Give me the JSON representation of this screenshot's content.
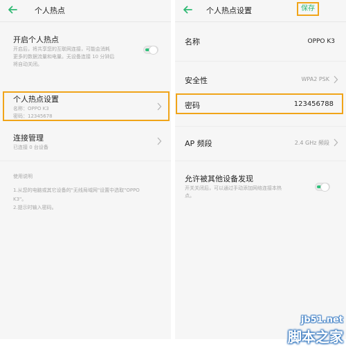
{
  "left_screen": {
    "header": {
      "title": "个人热点"
    },
    "hotspot_toggle": {
      "title": "开启个人热点",
      "description_lines": [
        "开启后，将共享您的互联网连接，可能会消耗",
        "更多的数据流量和电量。无设备连接 10 分钟后",
        "将自动关闭。"
      ],
      "enabled": true
    },
    "hotspot_settings": {
      "title": "个人热点设置",
      "name_line": "名称：OPPO K3",
      "password_line": "密码：12345678"
    },
    "connection_management": {
      "title": "连接管理",
      "subtitle": "已连接 0 台设备"
    },
    "instructions": {
      "heading": "使用说明",
      "lines": [
        "1.从您的电脑或其它设备的\"无线局域网\"设置中选取\"OPPO",
        "K3\"。",
        "2.提示时输入密码。"
      ]
    }
  },
  "right_screen": {
    "header": {
      "title": "个人热点设置",
      "save_label": "保存"
    },
    "name_field": {
      "label": "名称",
      "value": "OPPO K3"
    },
    "security_field": {
      "label": "安全性",
      "value": "WPA2 PSK"
    },
    "password_field": {
      "label": "密码",
      "value": "123456788"
    },
    "ap_band_field": {
      "label": "AP 频段",
      "value": "2.4 GHz 频段"
    },
    "discoverable": {
      "title": "允许被其他设备发现",
      "description_lines": [
        "开关关闭后，可以通过手动添加网络连接本热",
        "点。"
      ],
      "enabled": true
    }
  },
  "watermark": {
    "url": "jb51.net",
    "text": "脚本之家"
  },
  "colors": {
    "accent_green": "#2eb872",
    "highlight_orange": "#f0a418",
    "panel_background": "#f6f6f6"
  }
}
